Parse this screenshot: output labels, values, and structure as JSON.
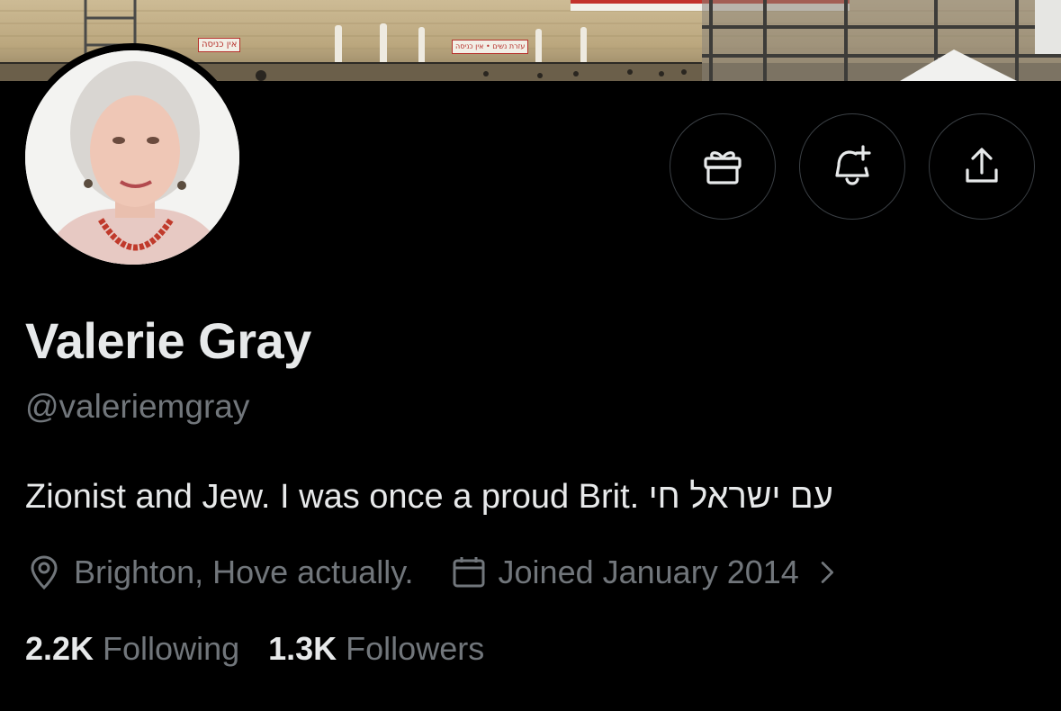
{
  "banner": {
    "sign_left": "אין כניסה",
    "sign_center": "עזרת נשים • אין כניסה"
  },
  "actions": [
    {
      "name": "subscribe",
      "icon": "gift-icon"
    },
    {
      "name": "notifications",
      "icon": "bell-plus-icon"
    },
    {
      "name": "share",
      "icon": "share-upload-icon"
    }
  ],
  "profile": {
    "name": "Valerie Gray",
    "handle": "@valeriemgray",
    "bio": "Zionist and Jew. I was once a proud Brit. עם ישראל חי",
    "location": "Brighton, Hove actually.",
    "joined": "Joined January 2014"
  },
  "stats": {
    "following_count": "2.2K",
    "following_label": "Following",
    "followers_count": "1.3K",
    "followers_label": "Followers"
  },
  "colors": {
    "background": "#000000",
    "primary_text": "#e7e9ea",
    "secondary_text": "#71767b",
    "button_border": "#3a3f44"
  }
}
